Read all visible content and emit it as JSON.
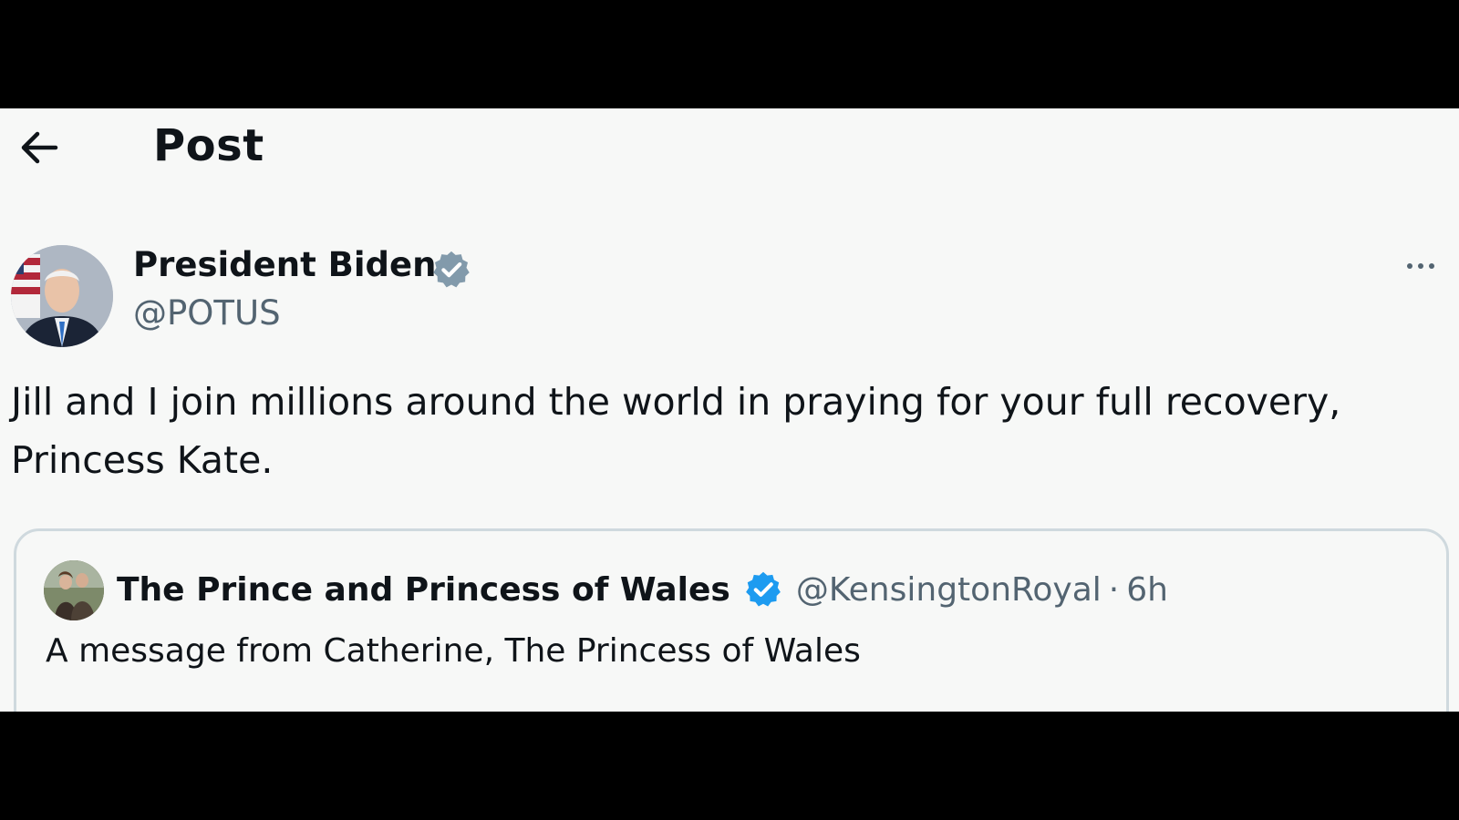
{
  "header": {
    "title": "Post",
    "back_icon": "arrow-left-icon"
  },
  "post": {
    "author_name": "President Biden",
    "author_handle": "@POTUS",
    "verified_icon": "verified-badge-icon",
    "verified_color": "#829aab",
    "more_icon": "more-horizontal-icon",
    "text": "Jill and I join millions around the world in praying for your full recovery,\nPrincess Kate."
  },
  "quote": {
    "author_name": "The Prince and Princess of Wales",
    "author_handle": "@KensingtonRoyal",
    "separator": "·",
    "time": "6h",
    "verified_color": "#1d9bf0",
    "text": "A message from Catherine, The Princess of Wales"
  },
  "colors": {
    "background": "#f7f8f7",
    "text_primary": "#0f1419",
    "text_secondary": "#536471",
    "letterbox": "#000000"
  }
}
